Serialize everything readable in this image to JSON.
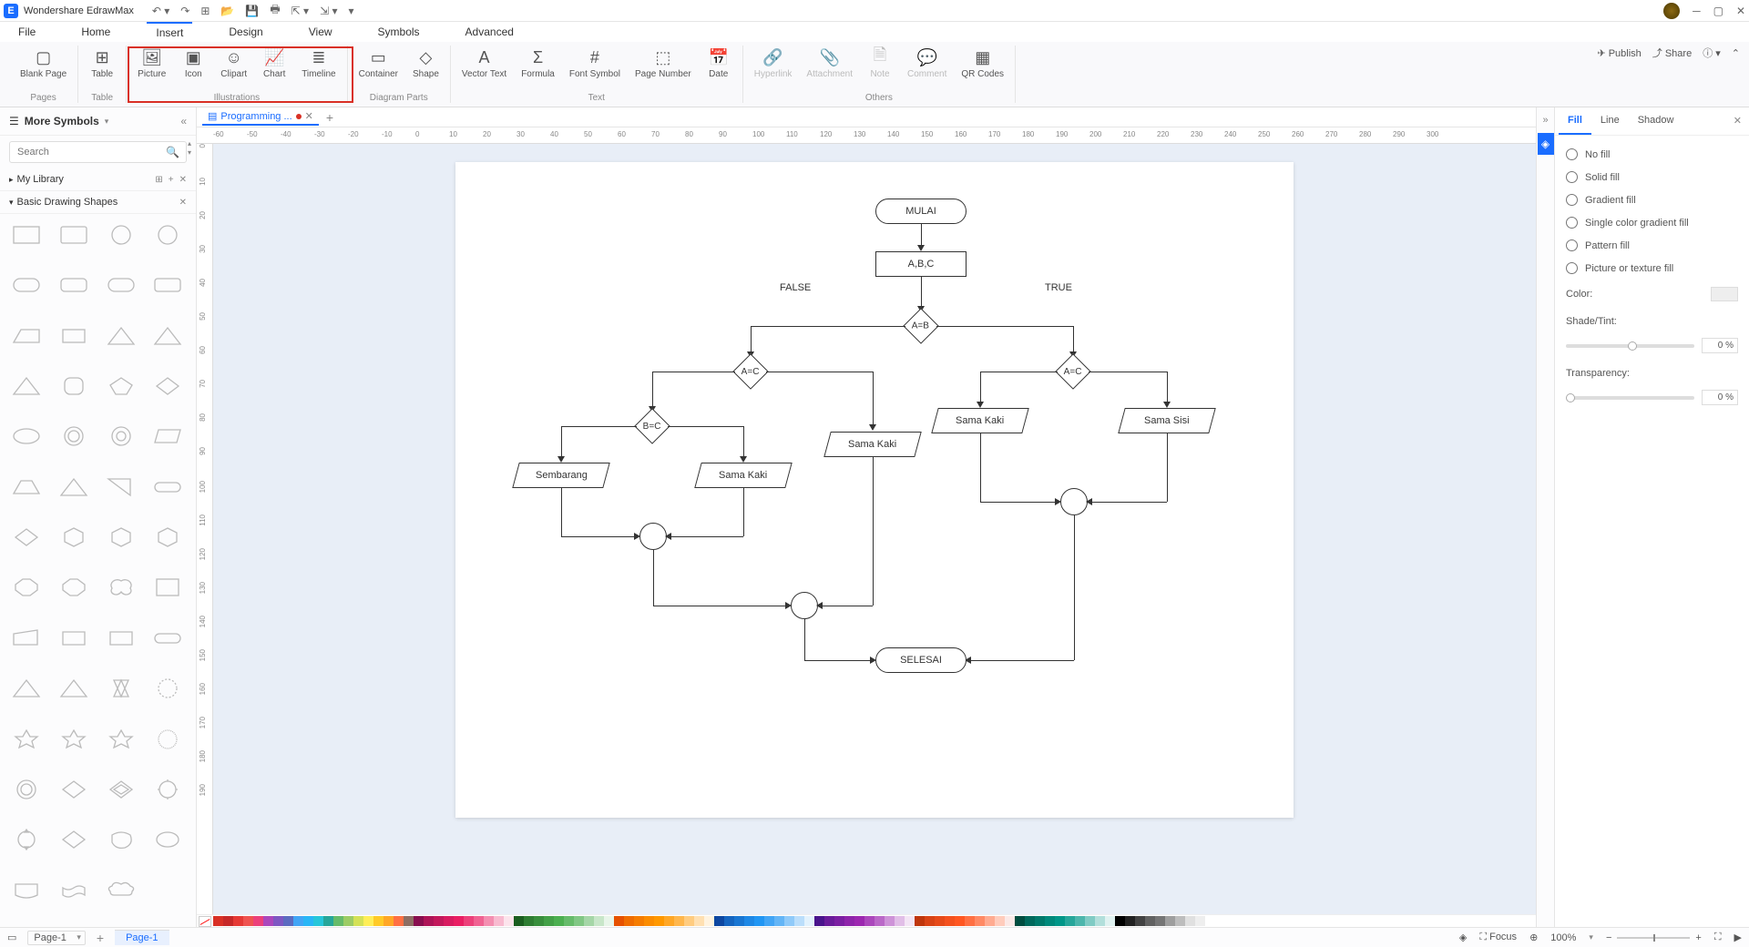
{
  "app": {
    "title": "Wondershare EdrawMax"
  },
  "menubar": {
    "items": [
      "File",
      "Home",
      "Insert",
      "Design",
      "View",
      "Symbols",
      "Advanced"
    ],
    "active": "Insert"
  },
  "ribbon_right": {
    "publish": "Publish",
    "share": "Share"
  },
  "ribbon": {
    "pages": {
      "blank": "Blank\nPage",
      "group": "Pages"
    },
    "table": {
      "table": "Table",
      "group": "Table"
    },
    "illustrations": {
      "picture": "Picture",
      "icon": "Icon",
      "clipart": "Clipart",
      "chart": "Chart",
      "timeline": "Timeline",
      "group": "Illustrations"
    },
    "diagramparts": {
      "container": "Container",
      "shape": "Shape",
      "group": "Diagram Parts"
    },
    "text": {
      "vector": "Vector\nText",
      "formula": "Formula",
      "fontsymbol": "Font\nSymbol",
      "pagenumber": "Page\nNumber",
      "date": "Date",
      "group": "Text"
    },
    "others": {
      "hyperlink": "Hyperlink",
      "attachment": "Attachment",
      "note": "Note",
      "comment": "Comment",
      "qr": "QR\nCodes",
      "group": "Others"
    }
  },
  "leftpanel": {
    "title": "More Symbols",
    "search_placeholder": "Search",
    "mylibrary": "My Library",
    "basicshapes": "Basic Drawing Shapes"
  },
  "tab": {
    "name": "Programming ..."
  },
  "ruler_h": [
    -60,
    -50,
    -40,
    -30,
    -20,
    -10,
    0,
    10,
    20,
    30,
    40,
    50,
    60,
    70,
    80,
    90,
    100,
    110,
    120,
    130,
    140,
    150,
    160,
    170,
    180,
    190,
    200,
    210,
    220,
    230,
    240,
    250,
    260,
    270,
    280,
    290,
    300
  ],
  "ruler_v": [
    0,
    10,
    20,
    30,
    40,
    50,
    60,
    70,
    80,
    90,
    100,
    110,
    120,
    130,
    140,
    150,
    160,
    170,
    180,
    190
  ],
  "flowchart": {
    "mulai": "MULAI",
    "abc": "A,B,C",
    "false": "FALSE",
    "true": "TRUE",
    "aeb": "A=B",
    "aec_l": "A=C",
    "aec_r": "A=C",
    "bec": "B=C",
    "sembarang": "Sembarang",
    "samakaki1": "Sama Kaki",
    "samakaki2": "Sama Kaki",
    "samakaki3": "Sama Kaki",
    "samasisi": "Sama Sisi",
    "selesai": "SELESAI"
  },
  "rightpanel": {
    "tabs": {
      "fill": "Fill",
      "line": "Line",
      "shadow": "Shadow"
    },
    "nofill": "No fill",
    "solidfill": "Solid fill",
    "gradientfill": "Gradient fill",
    "singlegradfill": "Single color gradient fill",
    "patternfill": "Pattern fill",
    "picturefill": "Picture or texture fill",
    "color": "Color:",
    "shadetint": "Shade/Tint:",
    "shadetint_val": "0 %",
    "transparency": "Transparency:",
    "transparency_val": "0 %"
  },
  "statusbar": {
    "page_sel": "Page-1",
    "page_tab": "Page-1",
    "focus": "Focus",
    "zoom": "100%"
  },
  "palette": [
    "#d93025",
    "#c62828",
    "#e53935",
    "#ef5350",
    "#ec407a",
    "#ab47bc",
    "#7e57c2",
    "#5c6bc0",
    "#42a5f5",
    "#29b6f6",
    "#26c6da",
    "#26a69a",
    "#66bb6a",
    "#9ccc65",
    "#d4e157",
    "#ffee58",
    "#ffca28",
    "#ffa726",
    "#ff7043",
    "#8d6e63",
    "#880e4f",
    "#ad1457",
    "#c2185b",
    "#d81b60",
    "#e91e63",
    "#ec407a",
    "#f06292",
    "#f48fb1",
    "#f8bbd0",
    "#fce4ec",
    "#1b5e20",
    "#2e7d32",
    "#388e3c",
    "#43a047",
    "#4caf50",
    "#66bb6a",
    "#81c784",
    "#a5d6a7",
    "#c8e6c9",
    "#e8f5e9",
    "#e65100",
    "#ef6c00",
    "#f57c00",
    "#fb8c00",
    "#ff9800",
    "#ffa726",
    "#ffb74d",
    "#ffcc80",
    "#ffe0b2",
    "#fff3e0",
    "#0d47a1",
    "#1565c0",
    "#1976d2",
    "#1e88e5",
    "#2196f3",
    "#42a5f5",
    "#64b5f6",
    "#90caf9",
    "#bbdefb",
    "#e3f2fd",
    "#4a148c",
    "#6a1b9a",
    "#7b1fa2",
    "#8e24aa",
    "#9c27b0",
    "#ab47bc",
    "#ba68c8",
    "#ce93d8",
    "#e1bee7",
    "#f3e5f5",
    "#bf360c",
    "#d84315",
    "#e64a19",
    "#f4511e",
    "#ff5722",
    "#ff7043",
    "#ff8a65",
    "#ffab91",
    "#ffccbc",
    "#fbe9e7",
    "#004d40",
    "#00695c",
    "#00796b",
    "#00897b",
    "#009688",
    "#26a69a",
    "#4db6ac",
    "#80cbc4",
    "#b2dfdb",
    "#e0f2f1",
    "#000000",
    "#212121",
    "#424242",
    "#616161",
    "#757575",
    "#9e9e9e",
    "#bdbdbd",
    "#e0e0e0",
    "#eeeeee",
    "#ffffff"
  ]
}
